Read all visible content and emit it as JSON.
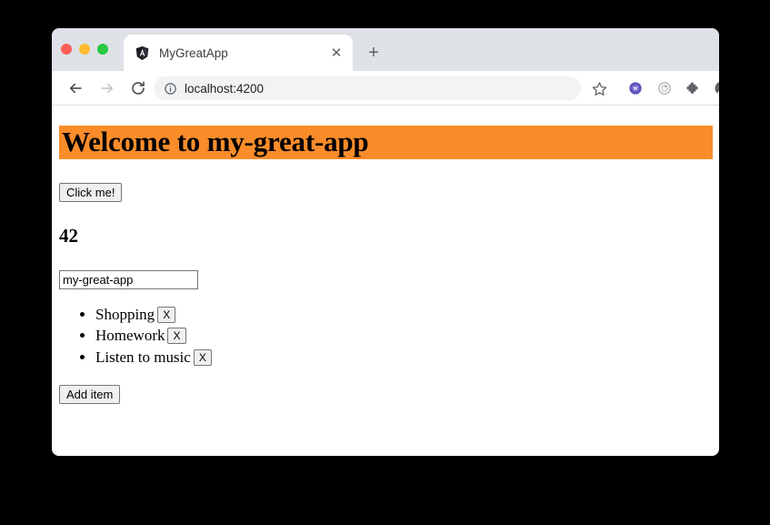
{
  "browser": {
    "window_controls": [
      {
        "name": "close",
        "color": "#ff5f57"
      },
      {
        "name": "minimize",
        "color": "#febc2e"
      },
      {
        "name": "zoom",
        "color": "#28c840"
      }
    ],
    "tab": {
      "title": "MyGreatApp",
      "favicon": "angular-shield-icon",
      "close_label": "✕"
    },
    "new_tab_label": "+",
    "navigation": {
      "back_label": "←",
      "forward_label": "→",
      "reload_label": "⟳"
    },
    "omnibox": {
      "site_info_icon": "info-circle-icon",
      "url": "localhost:4200"
    },
    "toolbar_icons": [
      {
        "name": "bookmark-star-icon",
        "color": "#5f6368"
      },
      {
        "name": "extension-one-icon",
        "color": "#5b53b8"
      },
      {
        "name": "extension-two-icon",
        "color": "#9aa0a6"
      },
      {
        "name": "extensions-puzzle-icon",
        "color": "#5f6368"
      },
      {
        "name": "profile-avatar-icon",
        "color": "#5f6368"
      },
      {
        "name": "update-arrow-icon",
        "color": "#1e8e3e"
      }
    ]
  },
  "page": {
    "banner": {
      "heading": "Welcome to my-great-app",
      "background_color": "#fb8c2a"
    },
    "click_button_label": "Click me!",
    "counter": "42",
    "name_input": {
      "value": "my-great-app",
      "placeholder": ""
    },
    "todo_items": [
      {
        "label": "Shopping",
        "remove_label": "X"
      },
      {
        "label": "Homework",
        "remove_label": "X"
      },
      {
        "label": "Listen to music",
        "remove_label": "X"
      }
    ],
    "add_item_label": "Add item"
  }
}
